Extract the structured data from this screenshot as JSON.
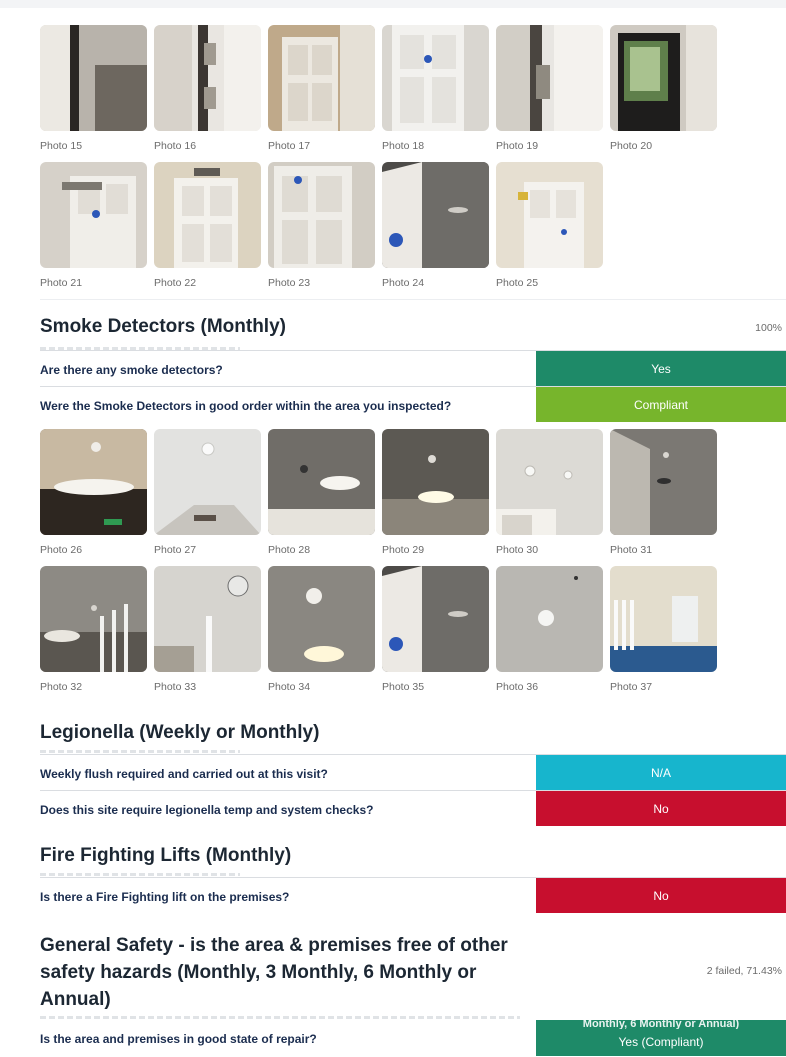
{
  "photos_row1": [
    "Photo 15",
    "Photo 16",
    "Photo 17",
    "Photo 18",
    "Photo 19",
    "Photo 20"
  ],
  "photos_row2": [
    "Photo 21",
    "Photo 22",
    "Photo 23",
    "Photo 24",
    "Photo 25"
  ],
  "photos_row3": [
    "Photo 26",
    "Photo 27",
    "Photo 28",
    "Photo 29",
    "Photo 30",
    "Photo 31"
  ],
  "photos_row4": [
    "Photo 32",
    "Photo 33",
    "Photo 34",
    "Photo 35",
    "Photo 36",
    "Photo 37"
  ],
  "sections": {
    "smoke": {
      "title": "Smoke Detectors (Monthly)",
      "score": "100%",
      "q1": "Are there any smoke detectors?",
      "a1": "Yes",
      "q2": "Were the Smoke Detectors in good order within the area you inspected?",
      "a2": "Compliant"
    },
    "legionella": {
      "title": "Legionella (Weekly or Monthly)",
      "q1": "Weekly flush required and carried out at this visit?",
      "a1": "N/A",
      "q2": "Does this site require legionella temp and system checks?",
      "a2": "No"
    },
    "lifts": {
      "title": "Fire Fighting Lifts (Monthly)",
      "q1": "Is there a Fire Fighting lift on the premises?",
      "a1": "No"
    },
    "general": {
      "title_l1": "General Safety - is the area & premises free of other",
      "title_l2": "safety hazards (Monthly, 3 Monthly, 6 Monthly or",
      "title_l3": "Annual)",
      "score": "2 failed, 71.43%",
      "q1": "Is the area and premises in good state of repair?",
      "a1": "Yes (Compliant)",
      "a1_overlap": "Monthly, 6 Monthly or Annual)"
    }
  },
  "colors": {
    "yes": "#1e8a68",
    "compliant": "#77b52c",
    "na": "#17b5cd",
    "no": "#c70f2e"
  }
}
